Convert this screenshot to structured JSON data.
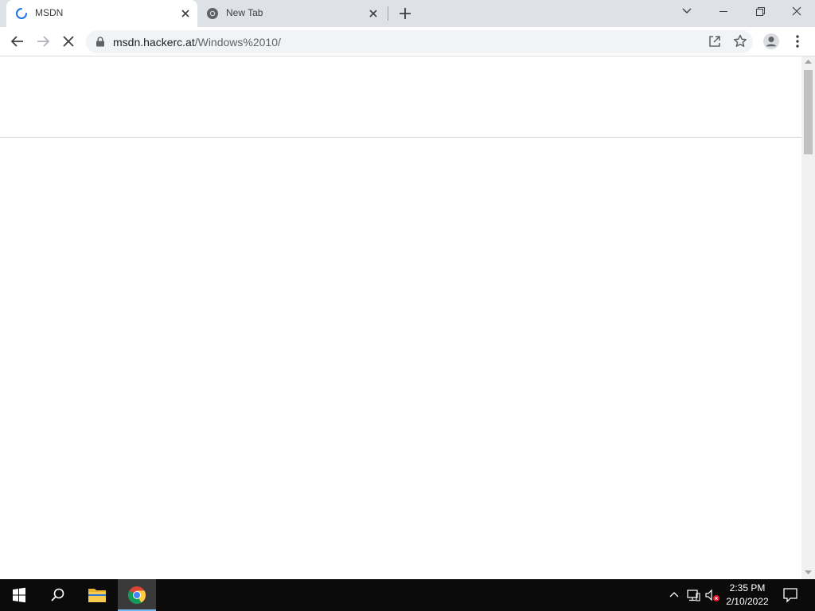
{
  "browser": {
    "tabs": [
      {
        "title": "MSDN",
        "active": true,
        "loading": true
      },
      {
        "title": "New Tab",
        "active": false
      }
    ],
    "address_bar": {
      "host": "msdn.hackerc.at",
      "path": "/Windows%2010/"
    }
  },
  "taskbar": {
    "clock_time": "2:35 PM",
    "clock_date": "2/10/2022"
  },
  "colors": {
    "tab_strip": "#dee1e6",
    "omnibox": "#f1f3f4",
    "taskbar": "#0b0b0b",
    "accent": "#1a73e8"
  },
  "icons": [
    "loading-spinner-icon",
    "chrome-icon",
    "close-icon",
    "plus-icon",
    "chevron-down-icon",
    "minimize-icon",
    "restore-icon",
    "back-arrow-icon",
    "forward-arrow-icon",
    "stop-icon",
    "lock-icon",
    "share-icon",
    "star-icon",
    "profile-icon",
    "kebab-menu-icon",
    "windows-logo-icon",
    "search-icon",
    "folder-icon",
    "network-icon",
    "volume-muted-icon",
    "notification-icon"
  ]
}
